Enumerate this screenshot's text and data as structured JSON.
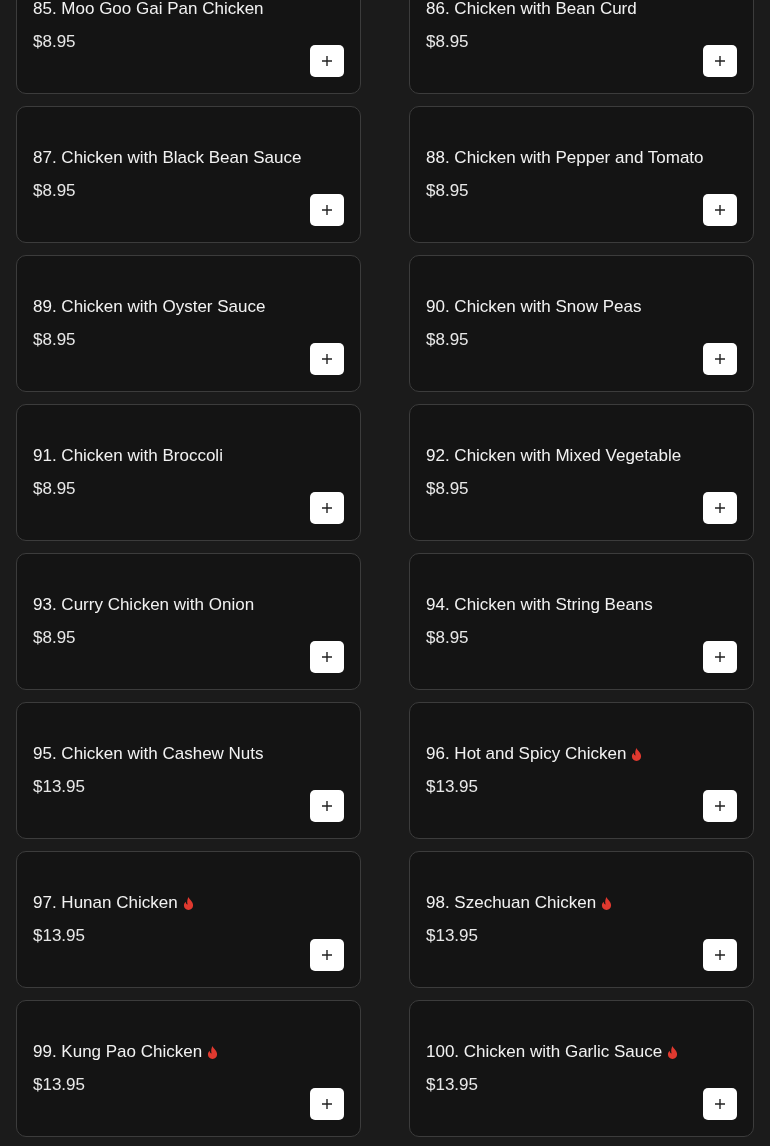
{
  "items": [
    {
      "name": "85. Moo Goo Gai Pan Chicken",
      "price": "$8.95",
      "spicy": false
    },
    {
      "name": "86. Chicken with Bean Curd",
      "price": "$8.95",
      "spicy": false
    },
    {
      "name": "87. Chicken with Black Bean Sauce",
      "price": "$8.95",
      "spicy": false
    },
    {
      "name": "88. Chicken with Pepper and Tomato",
      "price": "$8.95",
      "spicy": false
    },
    {
      "name": "89. Chicken with Oyster Sauce",
      "price": "$8.95",
      "spicy": false
    },
    {
      "name": "90. Chicken with Snow Peas",
      "price": "$8.95",
      "spicy": false
    },
    {
      "name": "91. Chicken with Broccoli",
      "price": "$8.95",
      "spicy": false
    },
    {
      "name": "92. Chicken with Mixed Vegetable",
      "price": "$8.95",
      "spicy": false
    },
    {
      "name": "93. Curry Chicken with Onion",
      "price": "$8.95",
      "spicy": false
    },
    {
      "name": "94. Chicken with String Beans",
      "price": "$8.95",
      "spicy": false
    },
    {
      "name": "95. Chicken with Cashew Nuts",
      "price": "$13.95",
      "spicy": false
    },
    {
      "name": "96. Hot and Spicy Chicken",
      "price": "$13.95",
      "spicy": true
    },
    {
      "name": "97. Hunan Chicken",
      "price": "$13.95",
      "spicy": true
    },
    {
      "name": "98. Szechuan Chicken",
      "price": "$13.95",
      "spicy": true
    },
    {
      "name": "99. Kung Pao Chicken",
      "price": "$13.95",
      "spicy": true
    },
    {
      "name": "100. Chicken with Garlic Sauce",
      "price": "$13.95",
      "spicy": true
    }
  ]
}
